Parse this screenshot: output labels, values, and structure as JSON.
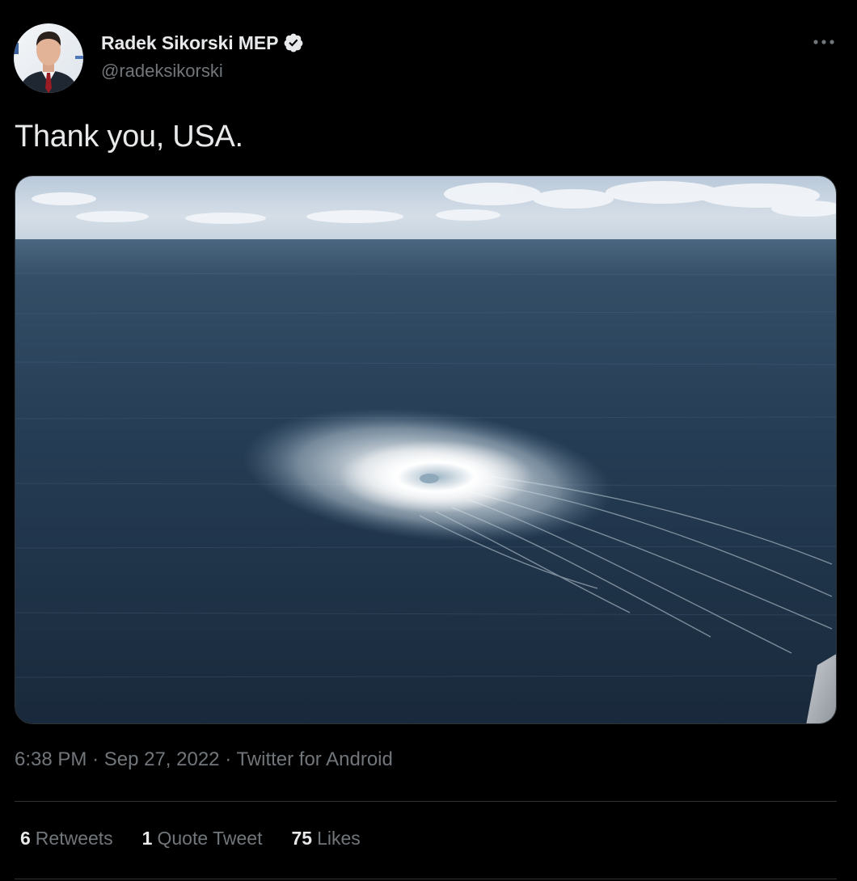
{
  "tweet": {
    "author": {
      "display_name": "Radek Sikorski MEP",
      "handle": "@radeksikorski",
      "verified": true,
      "avatar_icon": "profile-photo"
    },
    "text": "Thank you, USA.",
    "media": {
      "icon": "aerial-sea-photo"
    },
    "meta": {
      "time": "6:38 PM",
      "separator": "·",
      "date": "Sep 27, 2022",
      "source": "Twitter for Android"
    },
    "stats": {
      "retweets_count": "6",
      "retweets_label": "Retweets",
      "quotes_count": "1",
      "quotes_label": "Quote Tweet",
      "likes_count": "75",
      "likes_label": "Likes"
    }
  },
  "colors": {
    "background": "#000000",
    "text_primary": "#e7e9ea",
    "text_secondary": "#71767b",
    "divider": "#2f3336",
    "verified_badge": "#e7e9ea"
  }
}
